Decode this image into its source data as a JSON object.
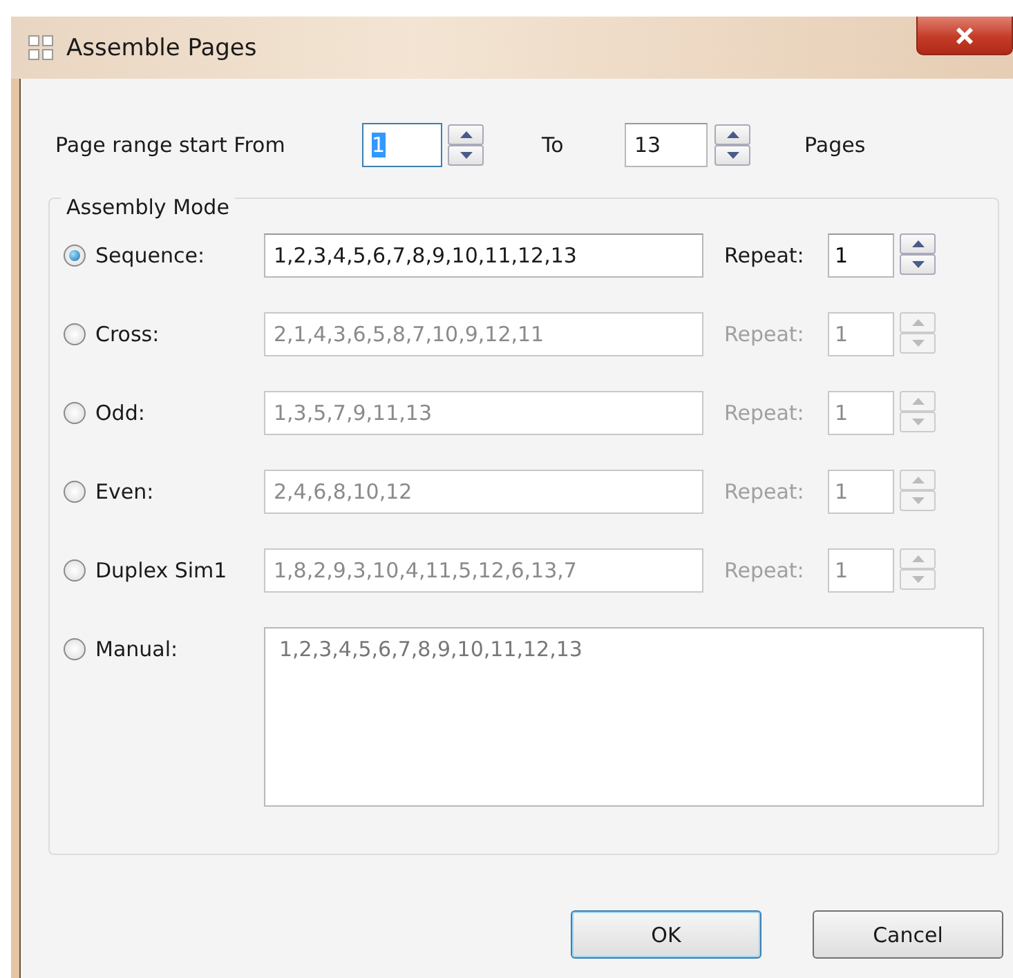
{
  "window": {
    "title": "Assemble Pages"
  },
  "page_range": {
    "from_label": "Page range start From",
    "from_value": "1",
    "from_value_highlighted": true,
    "to_label": "To",
    "to_value": "13",
    "units": "Pages"
  },
  "group": {
    "title": "Assembly Mode"
  },
  "modes": [
    {
      "kind": "line",
      "label": "Sequence:",
      "selected": true,
      "disabled": false,
      "value": "1,2,3,4,5,6,7,8,9,10,11,12,13",
      "repeat_label": "Repeat:",
      "repeat_value": "1"
    },
    {
      "kind": "line",
      "label": "Cross:",
      "selected": false,
      "disabled": true,
      "value": "2,1,4,3,6,5,8,7,10,9,12,11",
      "repeat_label": "Repeat:",
      "repeat_value": "1"
    },
    {
      "kind": "line",
      "label": "Odd:",
      "selected": false,
      "disabled": true,
      "value": "1,3,5,7,9,11,13",
      "repeat_label": "Repeat:",
      "repeat_value": "1"
    },
    {
      "kind": "line",
      "label": "Even:",
      "selected": false,
      "disabled": true,
      "value": "2,4,6,8,10,12",
      "repeat_label": "Repeat:",
      "repeat_value": "1"
    },
    {
      "kind": "line",
      "label": "Duplex Sim1",
      "selected": false,
      "disabled": true,
      "value": "1,8,2,9,3,10,4,11,5,12,6,13,7",
      "repeat_label": "Repeat:",
      "repeat_value": "1"
    },
    {
      "kind": "area",
      "label": "Manual:",
      "selected": false,
      "value": "1,2,3,4,5,6,7,8,9,10,11,12,13"
    }
  ],
  "buttons": [
    {
      "label": "OK",
      "default": true
    },
    {
      "label": "Cancel",
      "default": false
    }
  ]
}
